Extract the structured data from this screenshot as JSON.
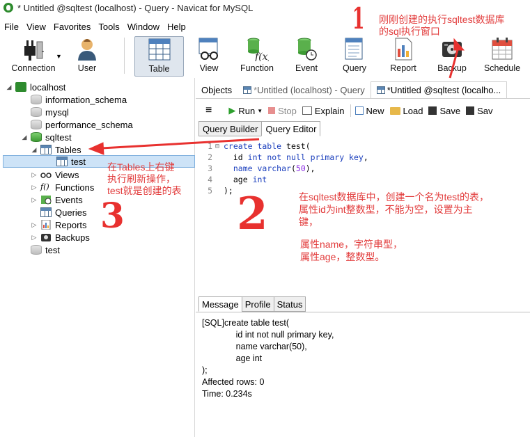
{
  "window": {
    "title": "* Untitled @sqltest (localhost) - Query - Navicat for MySQL"
  },
  "menu": [
    "File",
    "View",
    "Favorites",
    "Tools",
    "Window",
    "Help"
  ],
  "toolbar": {
    "items": [
      {
        "label": "Connection",
        "icon": "connection-icon"
      },
      {
        "label": "User",
        "icon": "user-icon"
      },
      {
        "label": "Table",
        "icon": "table-icon"
      },
      {
        "label": "View",
        "icon": "view-icon"
      },
      {
        "label": "Function",
        "icon": "function-icon"
      },
      {
        "label": "Event",
        "icon": "event-icon"
      },
      {
        "label": "Query",
        "icon": "query-icon"
      },
      {
        "label": "Report",
        "icon": "report-icon"
      },
      {
        "label": "Backup",
        "icon": "backup-icon"
      },
      {
        "label": "Schedule",
        "icon": "schedule-icon"
      }
    ]
  },
  "tree": {
    "connection": "localhost",
    "databases": [
      "information_schema",
      "mysql",
      "performance_schema",
      "sqltest"
    ],
    "sqltest_children": [
      "Tables",
      "Views",
      "Functions",
      "Events",
      "Queries",
      "Reports",
      "Backups"
    ],
    "table": "test",
    "other_db": "test"
  },
  "tabs": {
    "objects": "Objects",
    "tab1_star": "*",
    "tab1": " Untitled (localhost) - Query",
    "tab2_star": "*",
    "tab2": " Untitled @sqltest (localho..."
  },
  "query_toolbar": {
    "run": "Run",
    "stop": "Stop",
    "explain": "Explain",
    "new": "New",
    "load": "Load",
    "save": "Save",
    "save_as": "Sav"
  },
  "query_tabs": [
    "Query Builder",
    "Query Editor"
  ],
  "editor": {
    "line_numbers": [
      "1",
      "2",
      "3",
      "4",
      "5"
    ],
    "kw_create_table": "create table",
    "l1_rest": " test(",
    "l2_id": "id ",
    "kw_int": "int",
    "kw_not_null_pk": " not null primary key",
    "comma": ",",
    "l3_name": "name ",
    "kw_varchar": "varchar",
    "open_paren": "(",
    "num_50": "50",
    "close_paren_comma": "),",
    "l4_age": "age ",
    "kw_int2": "int",
    "l5": ");"
  },
  "message_tabs": [
    "Message",
    "Profile",
    "Status"
  ],
  "message": {
    "lines": [
      "[SQL]create table test(",
      "              id int not null primary key,",
      "              name varchar(50),",
      "              age int",
      ");",
      "Affected rows: 0",
      "Time: 0.234s"
    ]
  },
  "annotations": {
    "top": [
      "刚刚创建的执行sqltest数据库",
      "的sql执行窗口"
    ],
    "left": [
      "在Tables上右键",
      "执行刷新操作，",
      "test就是创建的表"
    ],
    "right1": [
      "在sqltest数据库中，创建一个名为test的表，",
      "属性id为int整数型，不能为空，设置为主",
      "键，"
    ],
    "right2": [
      "属性name，字符串型，",
      "属性age，整数型。"
    ],
    "num1": "1",
    "num2": "2",
    "num3": "3",
    "color": "#e23c3c"
  }
}
